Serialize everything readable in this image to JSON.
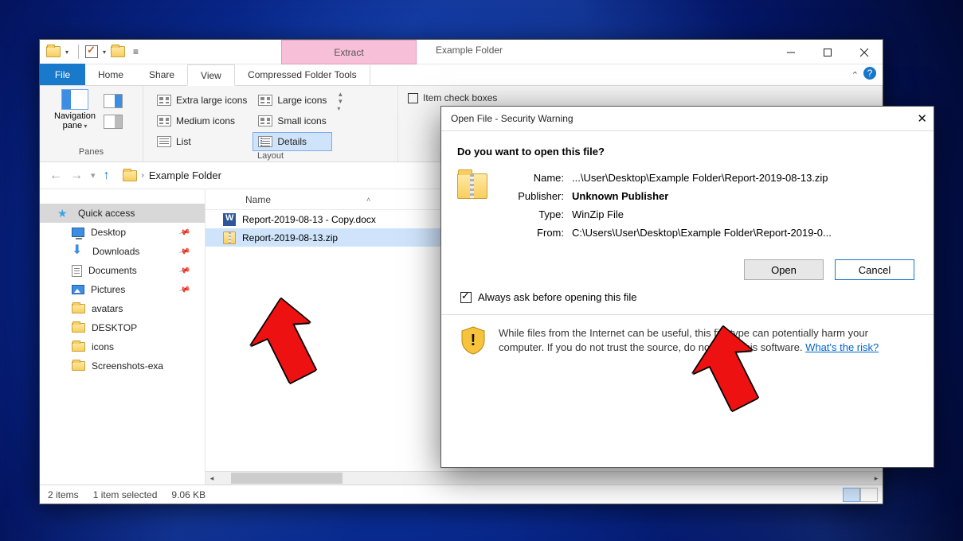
{
  "explorer": {
    "window_title": "Example Folder",
    "context_tab": "Extract",
    "tabs": {
      "file": "File",
      "home": "Home",
      "share": "Share",
      "view": "View",
      "ctx": "Compressed Folder Tools"
    },
    "ribbon": {
      "panes_label": "Panes",
      "navigation_pane": "Navigation\npane",
      "layout_label": "Layout",
      "layout_opts": {
        "xl": "Extra large icons",
        "lg": "Large icons",
        "md": "Medium icons",
        "sm": "Small icons",
        "list": "List",
        "details": "Details"
      },
      "item_check_boxes": "Item check boxes"
    },
    "breadcrumb": "Example Folder",
    "tree": {
      "quick_access": "Quick access",
      "desktop": "Desktop",
      "downloads": "Downloads",
      "documents": "Documents",
      "pictures": "Pictures",
      "avatars": "avatars",
      "desktop2": "DESKTOP",
      "icons": "icons",
      "screenshots": "Screenshots-exa"
    },
    "columns": {
      "name": "Name"
    },
    "files": [
      {
        "name": "Report-2019-08-13 - Copy.docx",
        "type": "docx",
        "selected": false
      },
      {
        "name": "Report-2019-08-13.zip",
        "type": "zip",
        "selected": true
      }
    ],
    "status": {
      "count": "2 items",
      "selection": "1 item selected",
      "size": "9.06 KB"
    }
  },
  "dialog": {
    "title": "Open File - Security Warning",
    "question": "Do you want to open this file?",
    "labels": {
      "name": "Name:",
      "publisher": "Publisher:",
      "type": "Type:",
      "from": "From:"
    },
    "values": {
      "name": "...\\User\\Desktop\\Example Folder\\Report-2019-08-13.zip",
      "publisher": "Unknown Publisher",
      "type": "WinZip File",
      "from": "C:\\Users\\User\\Desktop\\Example Folder\\Report-2019-0..."
    },
    "buttons": {
      "open": "Open",
      "cancel": "Cancel"
    },
    "checkbox": "Always ask before opening this file",
    "warning": "While files from the Internet can be useful, this file type can potentially harm your computer. If you do not trust the source, do not open this software. ",
    "risk_link": "What's the risk?"
  }
}
